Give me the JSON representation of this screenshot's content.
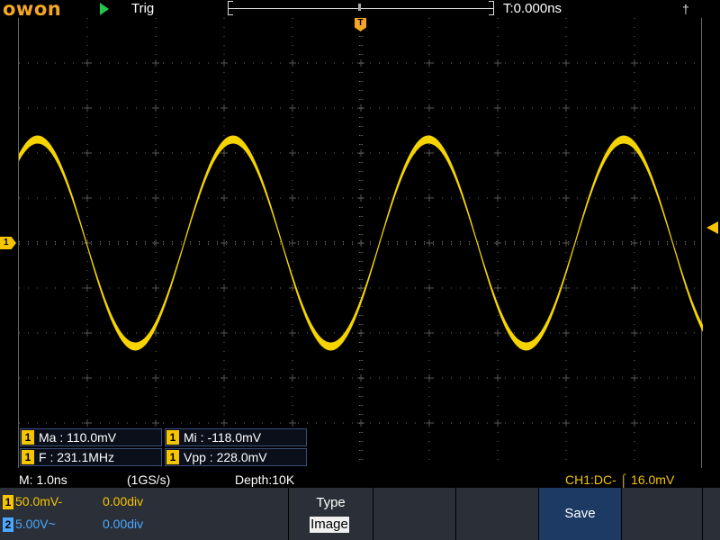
{
  "header": {
    "brand": "owon",
    "run_state": "Trig",
    "time_offset": "T:0.000ns"
  },
  "markers": {
    "trigger_position": "T",
    "channel1": "1"
  },
  "waveform": {
    "channel": "1",
    "color": "#f5d400",
    "cycles_on_screen": 3.5,
    "vertical_divs_peak": 2.3
  },
  "measurements": [
    {
      "channel": "1",
      "label": "Ma : 110.0mV"
    },
    {
      "channel": "1",
      "label": "Mi : -118.0mV"
    },
    {
      "channel": "1",
      "label": "F : 231.1MHz"
    },
    {
      "channel": "1",
      "label": "Vpp : 228.0mV"
    }
  ],
  "status": {
    "timebase": "M: 1.0ns",
    "sample_rate": "(1GS/s)",
    "depth": "Depth:10K",
    "trigger_info": "CH1:DC- ",
    "trigger_level": "16.0mV",
    "edge_icon": "rising-edge-icon"
  },
  "channels": [
    {
      "id": "1",
      "scale": "50.0mV",
      "coupling_symbol": "-",
      "offset": "0.00div",
      "color": "#f5c500"
    },
    {
      "id": "2",
      "scale": "5.00V",
      "coupling_symbol": "~",
      "offset": "0.00div",
      "color": "#4aa8ff"
    }
  ],
  "softkeys": {
    "type_title": "Type",
    "type_value": "Image",
    "save_label": "Save"
  },
  "colors": {
    "ch1": "#f5c500",
    "ch2": "#4aa8ff",
    "brand": "#f5a623",
    "run": "#22c84a",
    "save_key": "#1c3a64"
  }
}
